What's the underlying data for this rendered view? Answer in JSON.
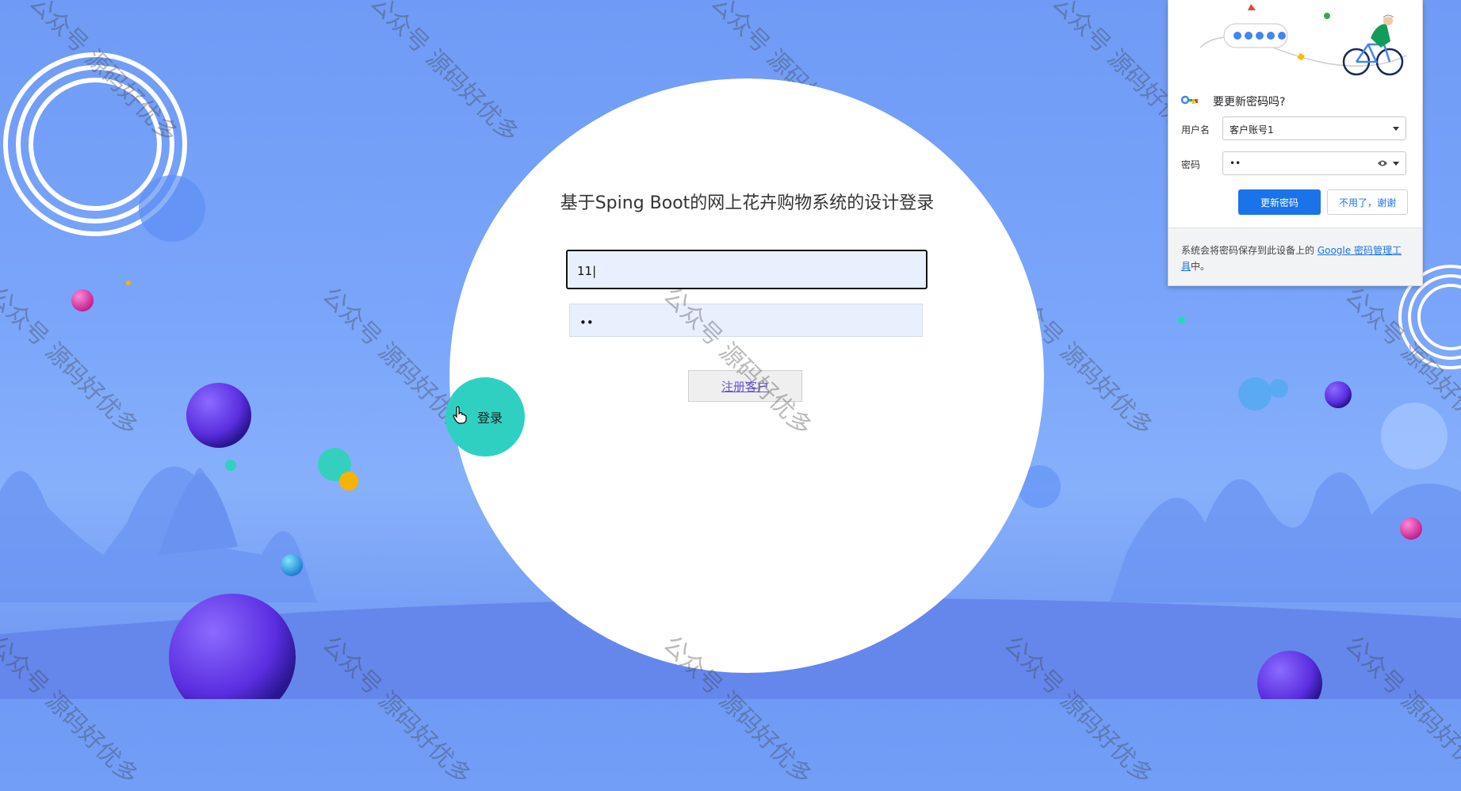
{
  "page": {
    "title": "基于Sping Boot的网上花卉购物系统的设计登录",
    "username_value": "11",
    "password_masked": "••",
    "register_label": "注册客户",
    "login_label": "登录"
  },
  "watermark": {
    "text": "公众号 源码好优多"
  },
  "password_popup": {
    "title": "要更新密码吗?",
    "username_label": "用户名",
    "username_value": "客户账号1",
    "password_label": "密码",
    "password_value": "••",
    "update_label": "更新密码",
    "cancel_label": "不用了，谢谢",
    "footer_prefix": "系统会将密码保存到此设备上的 ",
    "footer_link": "Google 密码管理工具",
    "footer_suffix": "中。"
  },
  "colors": {
    "accent": "#1a73e8",
    "login_button": "#2fd0c2",
    "background": "#7aa5fa"
  }
}
